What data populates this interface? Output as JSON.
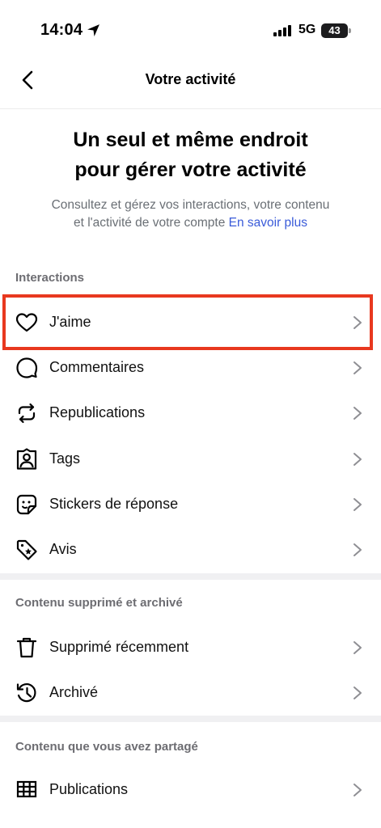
{
  "status_bar": {
    "time": "14:04",
    "network": "5G",
    "battery": "43"
  },
  "nav": {
    "title": "Votre activité"
  },
  "hero": {
    "title_line1": "Un seul et même endroit",
    "title_line2": "pour gérer votre activité",
    "description": "Consultez et gérez vos interactions, votre contenu et l'activité de votre compte",
    "link": "En savoir plus"
  },
  "sections": {
    "interactions": {
      "label": "Interactions",
      "items": [
        {
          "label": "J'aime",
          "icon": "heart-icon"
        },
        {
          "label": "Commentaires",
          "icon": "comment-icon"
        },
        {
          "label": "Republications",
          "icon": "repost-icon"
        },
        {
          "label": "Tags",
          "icon": "tag-person-icon"
        },
        {
          "label": "Stickers de réponse",
          "icon": "sticker-icon"
        },
        {
          "label": "Avis",
          "icon": "review-tag-icon"
        }
      ]
    },
    "deleted": {
      "label": "Contenu supprimé et archivé",
      "items": [
        {
          "label": "Supprimé récemment",
          "icon": "trash-icon"
        },
        {
          "label": "Archivé",
          "icon": "archive-icon"
        }
      ]
    },
    "shared": {
      "label": "Contenu que vous avez partagé",
      "items": [
        {
          "label": "Publications",
          "icon": "grid-icon"
        }
      ]
    }
  },
  "colors": {
    "highlight": "#e8381f",
    "link": "#3a5bd9",
    "secondary_text": "#6d6d72"
  }
}
